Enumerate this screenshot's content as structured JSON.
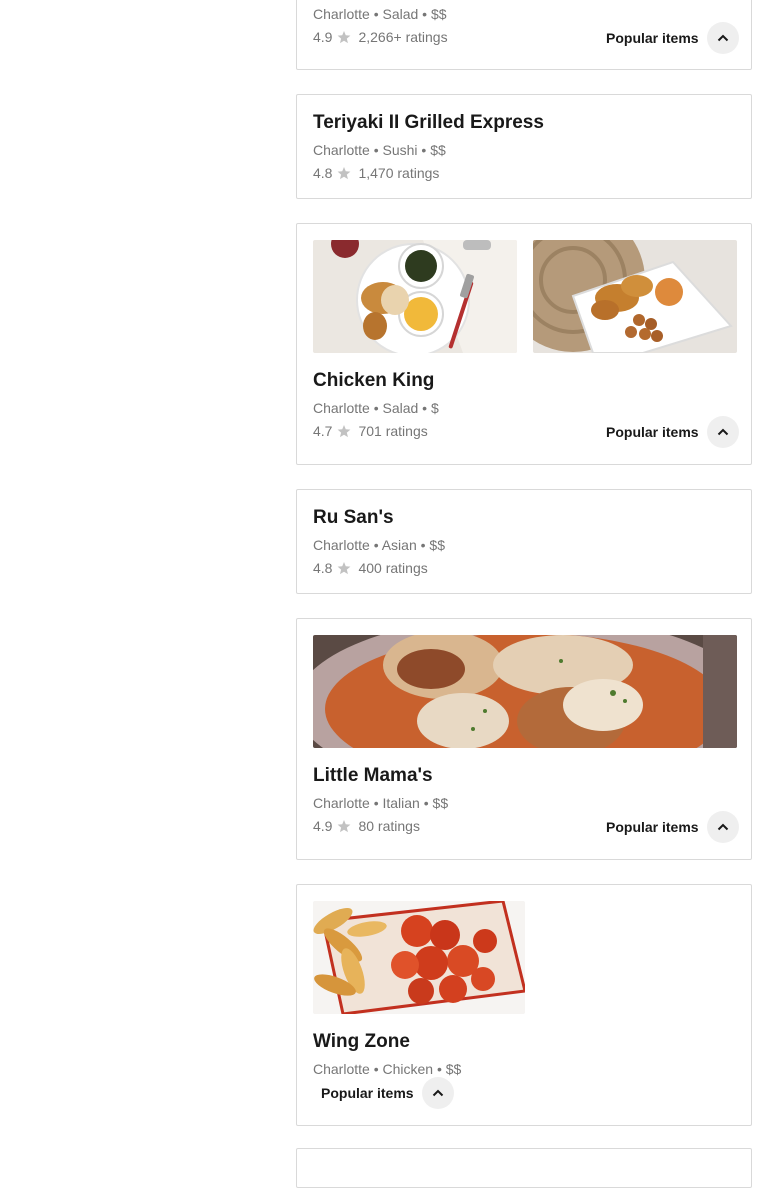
{
  "popular_label": "Popular items",
  "restaurants": [
    {
      "name": "",
      "meta": "Charlotte • Salad • $$",
      "rating": "4.9",
      "ratings_count": "2,266+ ratings"
    },
    {
      "name": "Teriyaki II Grilled Express",
      "meta": "Charlotte • Sushi • $$",
      "rating": "4.8",
      "ratings_count": "1,470 ratings"
    },
    {
      "name": "Chicken King",
      "meta": "Charlotte • Salad • $",
      "rating": "4.7",
      "ratings_count": "701 ratings"
    },
    {
      "name": "Ru San's",
      "meta": "Charlotte • Asian • $$",
      "rating": "4.8",
      "ratings_count": "400 ratings"
    },
    {
      "name": "Little Mama's",
      "meta": "Charlotte • Italian • $$",
      "rating": "4.9",
      "ratings_count": "80 ratings"
    },
    {
      "name": "Wing Zone",
      "meta": "Charlotte • Chicken • $$"
    }
  ],
  "icons": {
    "star": "star-icon",
    "chevron": "chevron-up-icon"
  },
  "colors": {
    "border": "#d9d9d9",
    "muted_text": "#767676",
    "chip_bg": "#efefef",
    "star": "#c2c2c2"
  }
}
